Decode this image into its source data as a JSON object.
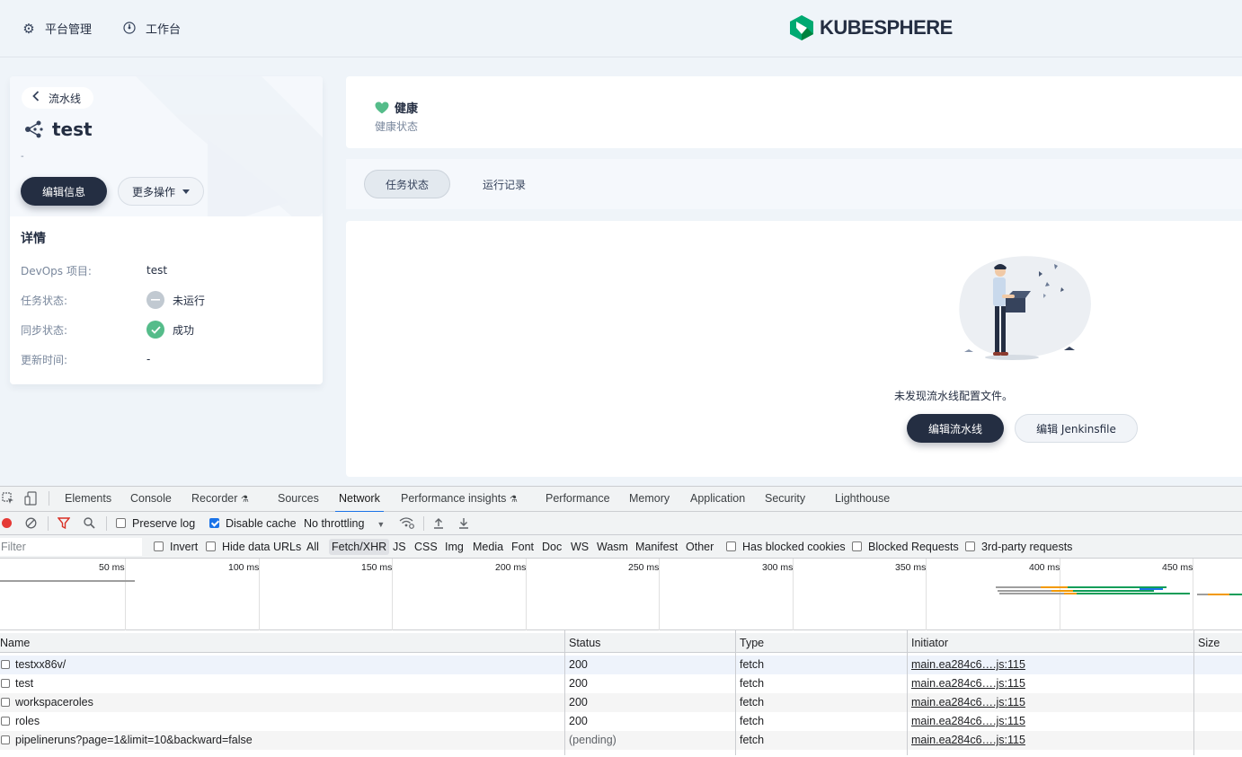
{
  "nav": {
    "platform_label": "平台管理",
    "workbench_label": "工作台",
    "logo_text": "KUBESPHERE"
  },
  "pipeline": {
    "back_label": "流水线",
    "name": "test",
    "description": "-",
    "edit_info_label": "编辑信息",
    "more_actions_label": "更多操作",
    "details_title": "详情",
    "details": [
      {
        "key": "DevOps 项目:",
        "value": "test"
      },
      {
        "key": "任务状态:",
        "value": "未运行"
      },
      {
        "key": "同步状态:",
        "value": "成功"
      },
      {
        "key": "更新时间:",
        "value": "-"
      }
    ]
  },
  "health": {
    "title": "健康",
    "subtitle": "健康状态",
    "color": "#55bc8a"
  },
  "tabs": [
    {
      "label": "任务状态",
      "active": true
    },
    {
      "label": "运行记录",
      "active": false
    }
  ],
  "empty": {
    "message": "未发现流水线配置文件。",
    "edit_pipeline_label": "编辑流水线",
    "edit_jenkinsfile_label": "编辑 Jenkinsfile"
  },
  "devtools": {
    "tabs": [
      "Elements",
      "Console",
      "Recorder",
      "Sources",
      "Network",
      "Performance insights",
      "Performance",
      "Memory",
      "Application",
      "Security",
      "Lighthouse"
    ],
    "active_tab": "Network",
    "preserve_log": "Preserve log",
    "disable_cache": "Disable cache",
    "throttling": "No throttling",
    "filter_placeholder": "Filter",
    "invert": "Invert",
    "hide_data_urls": "Hide data URLs",
    "types": [
      "All",
      "Fetch/XHR",
      "JS",
      "CSS",
      "Img",
      "Media",
      "Font",
      "Doc",
      "WS",
      "Wasm",
      "Manifest",
      "Other"
    ],
    "active_type": "Fetch/XHR",
    "has_blocked_cookies": "Has blocked cookies",
    "blocked_requests": "Blocked Requests",
    "third_party": "3rd-party requests",
    "timeline_ticks": [
      "50 ms",
      "100 ms",
      "150 ms",
      "200 ms",
      "250 ms",
      "300 ms",
      "350 ms",
      "400 ms",
      "450 ms"
    ],
    "columns": [
      "Name",
      "Status",
      "Type",
      "Initiator",
      "Size"
    ],
    "rows": [
      {
        "name": "testxx86v/",
        "status": "200",
        "type": "fetch",
        "initiator": "main.ea284c6….js:115"
      },
      {
        "name": "test",
        "status": "200",
        "type": "fetch",
        "initiator": "main.ea284c6….js:115"
      },
      {
        "name": "workspaceroles",
        "status": "200",
        "type": "fetch",
        "initiator": "main.ea284c6….js:115"
      },
      {
        "name": "roles",
        "status": "200",
        "type": "fetch",
        "initiator": "main.ea284c6….js:115"
      },
      {
        "name": "pipelineruns?page=1&limit=10&backward=false",
        "status": "(pending)",
        "type": "fetch",
        "initiator": "main.ea284c6….js:115"
      }
    ]
  }
}
